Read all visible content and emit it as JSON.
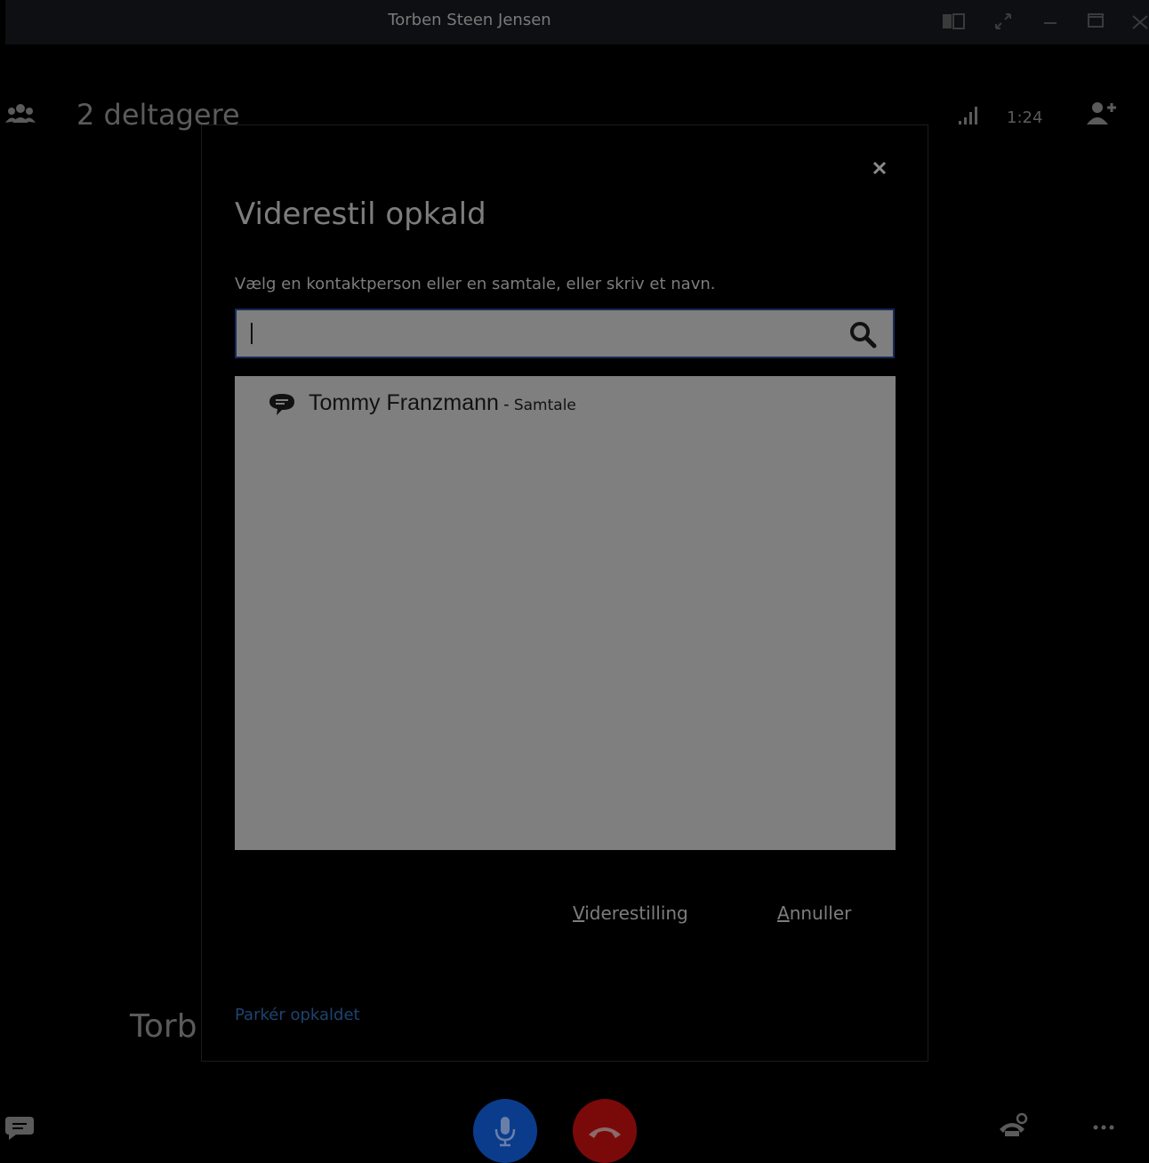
{
  "window": {
    "title": "Torben Steen Jensen"
  },
  "header": {
    "participants_label": "2 deltagere",
    "call_timer": "1:24"
  },
  "caller": {
    "name_partial": "Torb"
  },
  "dialog": {
    "title": "Viderestil opkald",
    "instruction": "Vælg en kontaktperson eller en samtale, eller skriv et navn.",
    "search": {
      "value": "",
      "placeholder": ""
    },
    "results": [
      {
        "name": "Tommy Franzmann",
        "separator": " - ",
        "type": "Samtale"
      }
    ],
    "transfer_button": {
      "accel": "V",
      "rest": "iderestilling"
    },
    "cancel_button": {
      "accel": "A",
      "rest": "nnuller"
    },
    "park_link": "Parkér opkaldet"
  },
  "colors": {
    "mic_button": "#0b3c8c",
    "hangup_button": "#7a0a0a",
    "list_background": "#7f7f7f",
    "link": "#1e4470"
  },
  "icons": {
    "participants": "people-group-icon",
    "signal": "signal-bars-icon",
    "add_person": "add-person-icon",
    "chat": "chat-bubble-icon",
    "mic": "microphone-icon",
    "hangup": "phone-hangup-icon",
    "call_controls": "phone-settings-icon",
    "more": "more-dots-icon"
  }
}
